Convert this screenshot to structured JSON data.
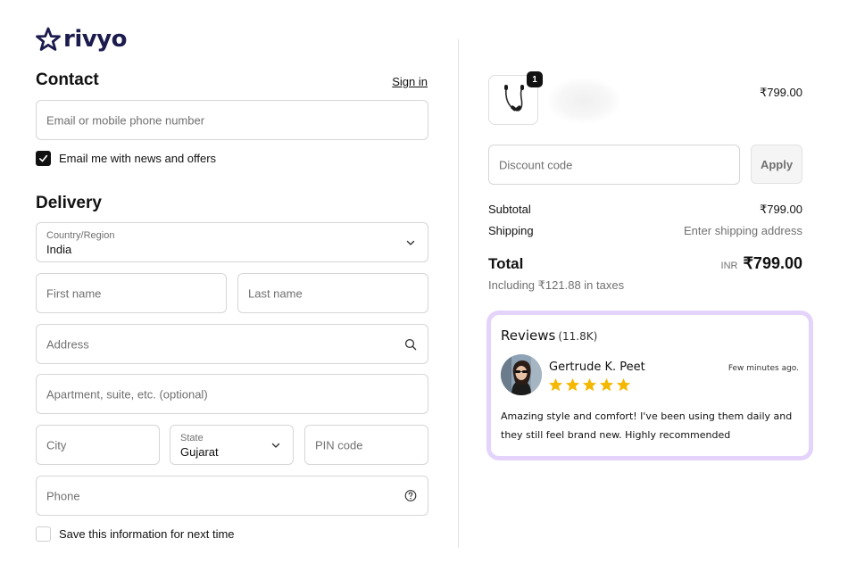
{
  "brand": {
    "name": "rivyo",
    "color": "#1c1b4d"
  },
  "contact": {
    "title": "Contact",
    "sign_in": "Sign in",
    "email_placeholder": "Email or mobile phone number",
    "newsletter_label": "Email me with news and offers",
    "newsletter_checked": true
  },
  "delivery": {
    "title": "Delivery",
    "country_label": "Country/Region",
    "country_value": "India",
    "first_name_placeholder": "First name",
    "last_name_placeholder": "Last name",
    "address_placeholder": "Address",
    "apartment_placeholder": "Apartment, suite, etc. (optional)",
    "city_placeholder": "City",
    "state_label": "State",
    "state_value": "Gujarat",
    "pin_placeholder": "PIN code",
    "phone_placeholder": "Phone",
    "save_info_label": "Save this information for next time",
    "save_info_checked": false
  },
  "order": {
    "item": {
      "quantity": "1",
      "price": "₹799.00",
      "icon": "earphones-icon"
    },
    "discount_placeholder": "Discount code",
    "apply_label": "Apply",
    "subtotal_label": "Subtotal",
    "subtotal_value": "₹799.00",
    "shipping_label": "Shipping",
    "shipping_value": "Enter shipping address",
    "total_label": "Total",
    "currency": "INR",
    "total_value": "₹799.00",
    "tax_note": "Including ₹121.88 in taxes"
  },
  "reviews": {
    "title": "Reviews",
    "count": "(11.8K)",
    "border_color": "#e4d3fb",
    "review": {
      "author": "Gertrude K. Peet",
      "time": "Few minutes ago.",
      "rating": 5,
      "star_color": "#f5b800",
      "text": "Amazing style and comfort! I've been using them daily and they still feel brand new. Highly recommended"
    }
  }
}
